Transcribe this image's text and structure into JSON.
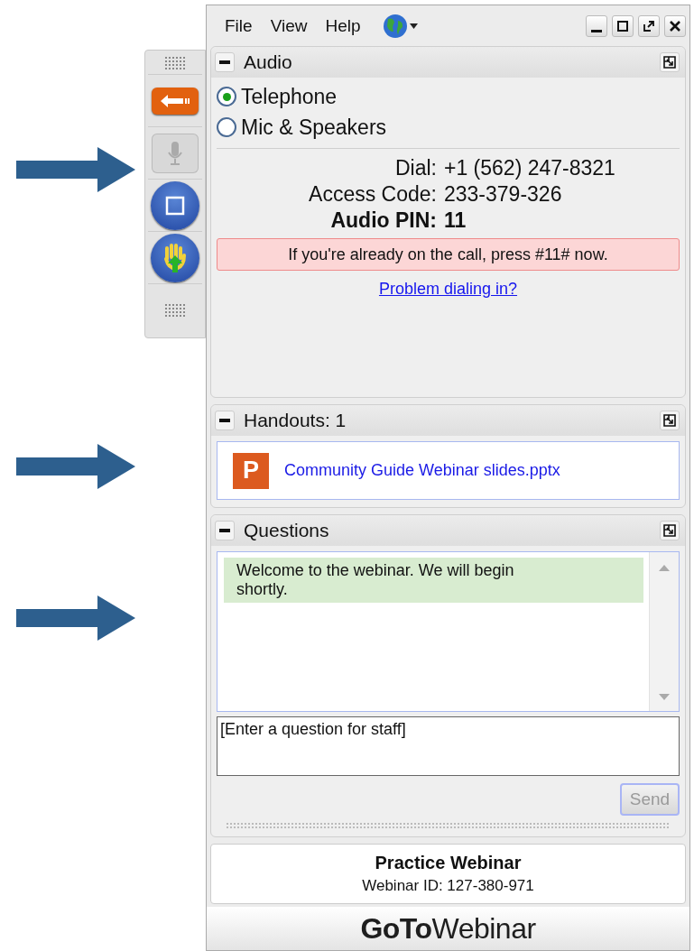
{
  "menu": [
    {
      "label": "File"
    },
    {
      "label": "View"
    },
    {
      "label": "Help"
    }
  ],
  "toolbar": [
    {
      "kind": "arrow",
      "disabled": false
    },
    {
      "kind": "mic",
      "disabled": true
    },
    {
      "kind": "screen",
      "disabled": false
    },
    {
      "kind": "hand",
      "disabled": false
    }
  ],
  "audio": {
    "title": "Audio",
    "options": [
      {
        "label": "Telephone",
        "selected": true
      },
      {
        "label": "Mic & Speakers",
        "selected": false
      }
    ],
    "details": [
      {
        "label": "Dial:",
        "value": "+1 (562) 247-8321",
        "bold": false
      },
      {
        "label": "Access Code:",
        "value": "233-379-326",
        "bold": false
      },
      {
        "label": "Audio PIN:",
        "value": "11",
        "bold": true
      }
    ],
    "notice": "If you're already on the call, press #11# now.",
    "link": "Problem dialing in?"
  },
  "handouts": {
    "title": "Handouts: 1",
    "files": [
      {
        "badge": "P",
        "name": "Community Guide Webinar slides.pptx"
      }
    ]
  },
  "questions": {
    "title": "Questions",
    "messages": [
      {
        "text": "Welcome to the webinar. We will begin shortly."
      }
    ],
    "placeholder": "[Enter a question for staff]",
    "send": {
      "label": "Send",
      "disabled": true
    }
  },
  "footer": {
    "title": "Practice Webinar",
    "id": "Webinar ID: 127-380-971",
    "logo_bold": "GoTo",
    "logo_light": "Webinar"
  }
}
